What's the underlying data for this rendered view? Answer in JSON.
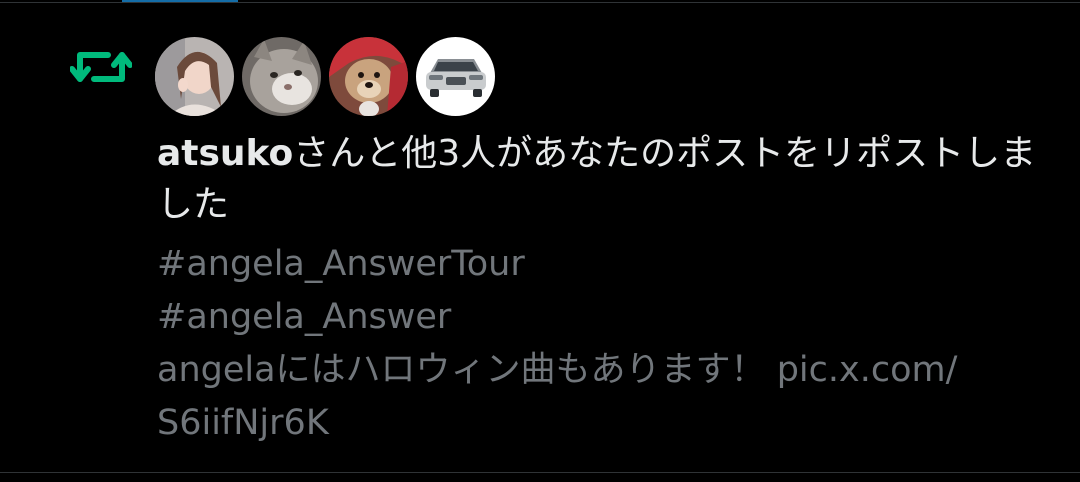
{
  "notification": {
    "type_icon": "repost-icon",
    "accent_color": "#00ba7c",
    "avatars": [
      {
        "icon": "avatar-woman-icon"
      },
      {
        "icon": "avatar-cat-icon"
      },
      {
        "icon": "avatar-dog-icon"
      },
      {
        "icon": "avatar-car-icon"
      }
    ],
    "actor_name": "atsuko",
    "message": "さんと他3人があなたのポストをリポストしました",
    "post": {
      "hashtag_1": "#angela_AnswerTour",
      "hashtag_2": "#angela_Answer",
      "body": "angelaにはハロウィン曲もあります！ ",
      "link_part_1": "pic.x.com/",
      "link_part_2": "S6iifNjr6K"
    }
  },
  "colors": {
    "background": "#000000",
    "primary_text": "#e7e9ea",
    "secondary_text": "#71767b",
    "divider": "#2f3336",
    "tab_indicator": "#1d9bf0"
  }
}
